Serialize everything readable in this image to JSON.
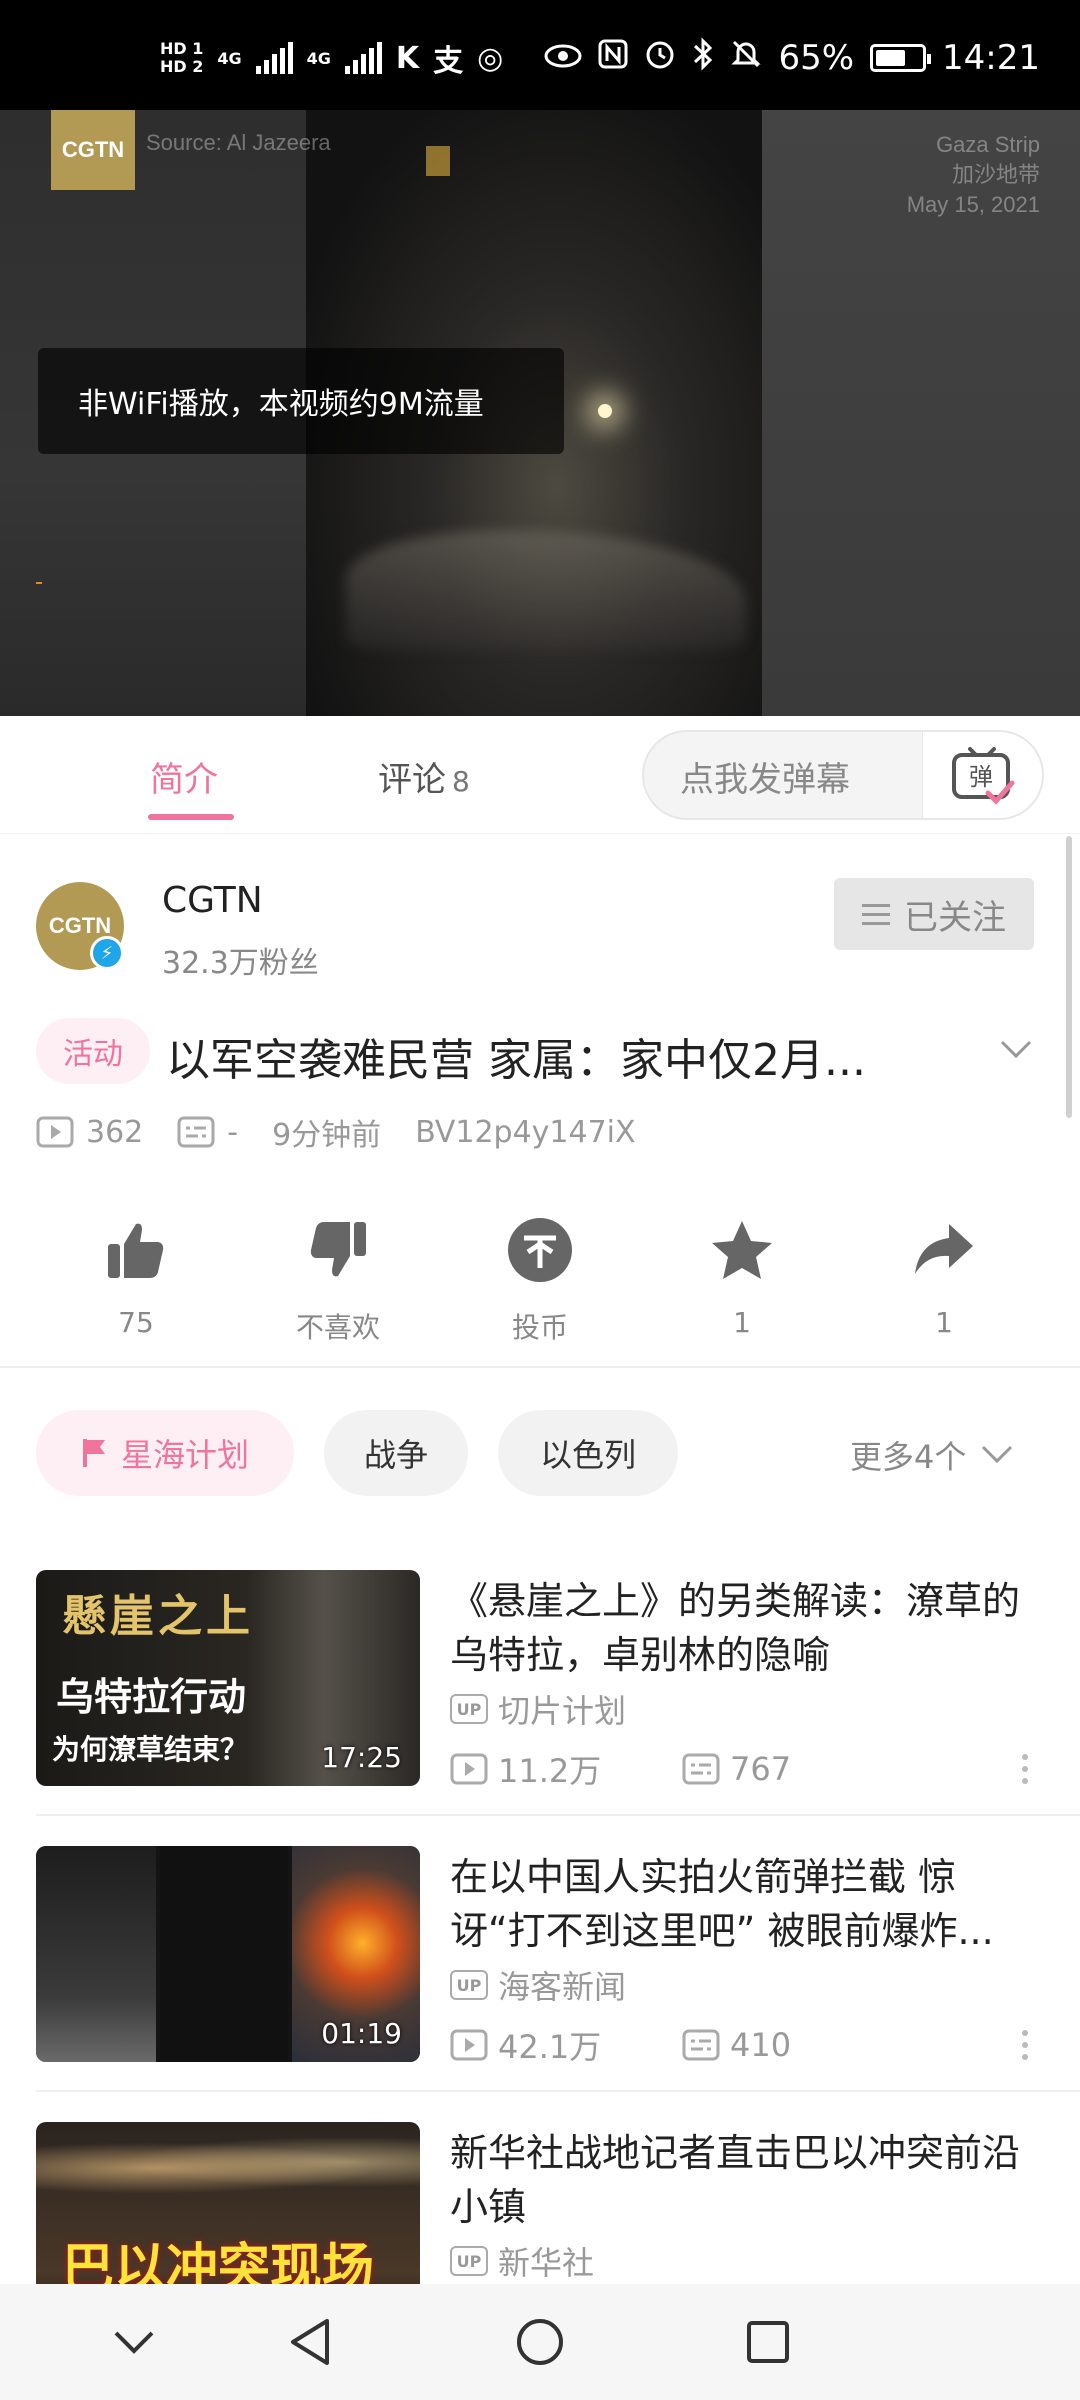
{
  "status_bar": {
    "hd1": "HD 1",
    "hd2": "HD 2",
    "net1": "4G",
    "net2": "4G",
    "battery_percent": "65%",
    "battery_level": 0.65,
    "time": "14:21"
  },
  "video": {
    "channel_logo": "CGTN",
    "source_text": "Source: Al Jazeera",
    "place_en": "Gaza Strip",
    "place_zh": "加沙地带",
    "date": "May 15, 2021",
    "toast": "非WiFi播放，本视频约9M流量"
  },
  "tabs": {
    "intro": "简介",
    "comments": "评论",
    "comments_count": "8",
    "danmaku_placeholder": "点我发弹幕",
    "danmaku_icon_char": "弹"
  },
  "uploader": {
    "avatar_text": "CGTN",
    "name": "CGTN",
    "fans": "32.3万粉丝",
    "follow_label": "已关注"
  },
  "title": {
    "tag": "活动",
    "text": "以军空袭难民营 家属：家中仅2月..."
  },
  "meta": {
    "views": "362",
    "danmaku": "-",
    "time": "9分钟前",
    "bvid": "BV12p4y147iX"
  },
  "actions": [
    {
      "icon": "thumbs-up-icon",
      "label": "75"
    },
    {
      "icon": "thumbs-down-icon",
      "label": "不喜欢"
    },
    {
      "icon": "coin-icon",
      "label": "投币"
    },
    {
      "icon": "star-icon",
      "label": "1"
    },
    {
      "icon": "share-icon",
      "label": "1"
    }
  ],
  "tags": {
    "items": [
      "星海计划",
      "战争",
      "以色列"
    ],
    "more": "更多4个"
  },
  "related": [
    {
      "title": "《悬崖之上》的另类解读：潦草的乌特拉，卓别林的隐喻",
      "up": "切片计划",
      "views": "11.2万",
      "danmaku": "767",
      "duration": "17:25",
      "thumb_line1": "懸崖之上",
      "thumb_line2": "乌特拉行动",
      "thumb_line3": "为何潦草结束？"
    },
    {
      "title": "在以中国人实拍火箭弹拦截 惊讶“打不到这里吧” 被眼前爆炸...",
      "up": "海客新闻",
      "views": "42.1万",
      "danmaku": "410",
      "duration": "01:19"
    },
    {
      "title": "新华社战地记者直击巴以冲突前沿小镇",
      "up": "新华社",
      "thumb_line1": "巴以冲突现场"
    }
  ],
  "colors": {
    "accent": "#f0749b",
    "accent_bg": "#fdeff4",
    "cgtn_gold": "#b39a54",
    "verified_blue": "#1fa6e8"
  }
}
